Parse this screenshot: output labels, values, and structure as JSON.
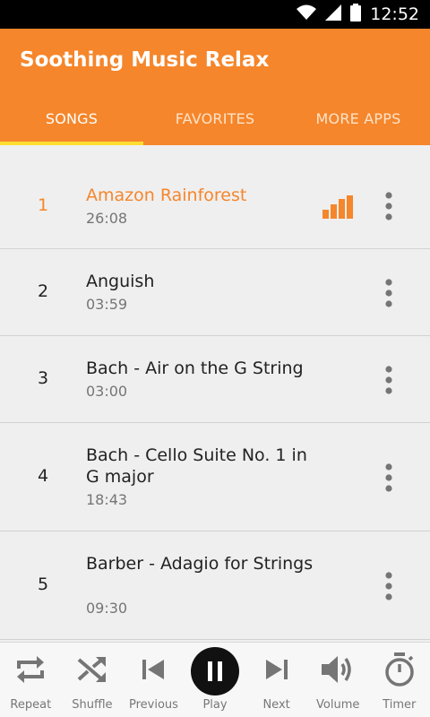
{
  "status_bar": {
    "time": "12:52",
    "icons": [
      "wifi-icon",
      "cell-signal-icon",
      "battery-icon"
    ]
  },
  "app": {
    "title": "Soothing Music Relax",
    "accent": "#f5862b",
    "indicator": "#ffdd33"
  },
  "tabs": [
    {
      "label": "SONGS",
      "active": true
    },
    {
      "label": "FAVORITES",
      "active": false
    },
    {
      "label": "MORE APPS",
      "active": false
    }
  ],
  "songs": [
    {
      "number": "1",
      "title": "Amazon Rainforest",
      "duration": "26:08",
      "playing": true
    },
    {
      "number": "2",
      "title": "Anguish",
      "duration": "03:59",
      "playing": false
    },
    {
      "number": "3",
      "title": "Bach - Air on the G String",
      "duration": "03:00",
      "playing": false
    },
    {
      "number": "4",
      "title": "Bach - Cello Suite No. 1 in G major",
      "duration": "18:43",
      "playing": false
    },
    {
      "number": "5",
      "title": "Barber - Adagio for Strings",
      "duration": "09:30",
      "playing": false
    }
  ],
  "player": {
    "controls": [
      {
        "label": "Repeat",
        "icon": "repeat-icon"
      },
      {
        "label": "Shuffle",
        "icon": "shuffle-icon"
      },
      {
        "label": "Previous",
        "icon": "previous-icon"
      },
      {
        "label": "Play",
        "icon": "pause-icon"
      },
      {
        "label": "Next",
        "icon": "next-icon"
      },
      {
        "label": "Volume",
        "icon": "volume-icon"
      },
      {
        "label": "Timer",
        "icon": "timer-icon"
      }
    ]
  }
}
